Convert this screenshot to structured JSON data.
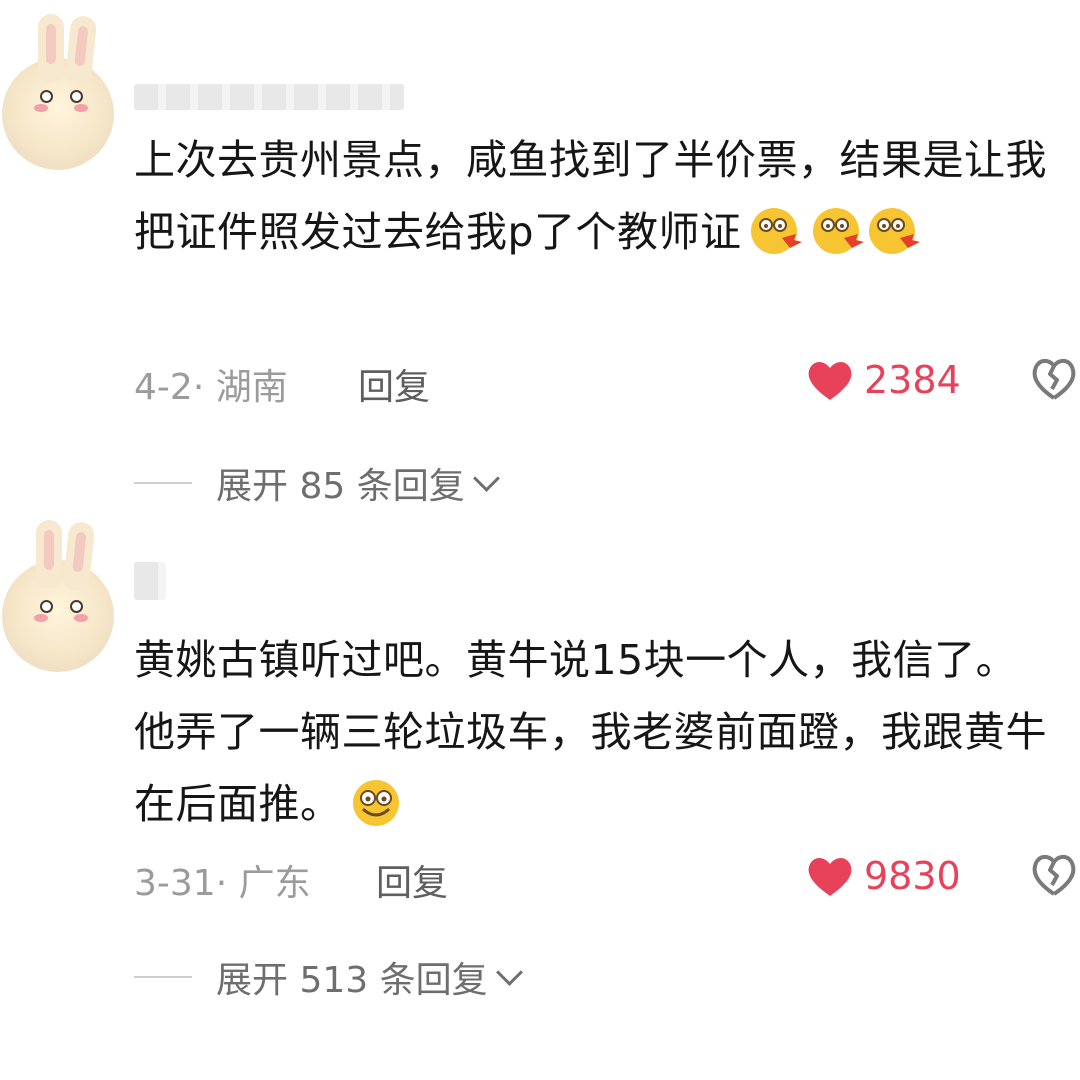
{
  "comments": [
    {
      "text": "上次去贵州景点，咸鱼找到了半价票，结果是让我把证件照发过去给我p了个教师证",
      "emoji_name": "heart-eyes-kiss-emoji",
      "date": "4-2",
      "location": "湖南",
      "reply_label": "回复",
      "likes": "2384",
      "expand_label": "展开 85 条回复"
    },
    {
      "text": "黄姚古镇听过吧。黄牛说15块一个人，我信了。他弄了一辆三轮垃圾车，我老婆前面蹬，我跟黄牛在后面推。",
      "emoji_name": "smile-emoji",
      "date": "3-31",
      "location": "广东",
      "reply_label": "回复",
      "likes": "9830",
      "expand_label": "展开 513 条回复"
    }
  ],
  "colors": {
    "like": "#e8425a",
    "text": "#161616",
    "meta": "#9b9b9b"
  }
}
